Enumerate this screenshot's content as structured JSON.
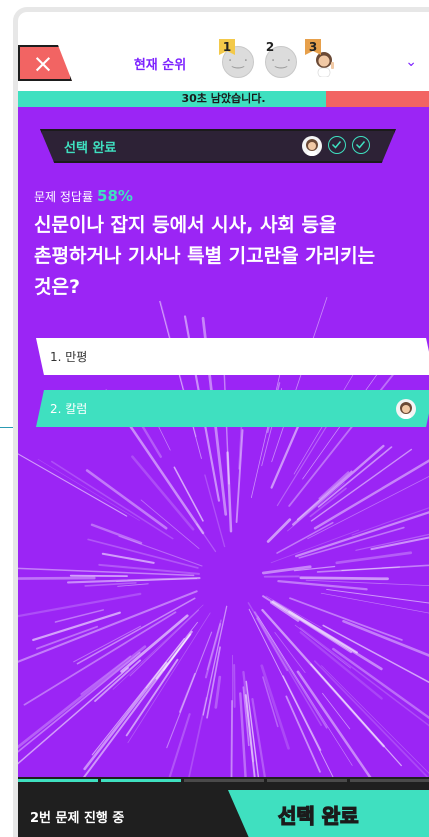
{
  "header": {
    "close_symbol": "×",
    "rank_title": "현재 순위",
    "ranks": [
      {
        "badge": "1",
        "face": "·‿·",
        "icon": "gold-medal-icon"
      },
      {
        "badge": "2",
        "face": "·‿·",
        "icon": "silver-medal-icon"
      },
      {
        "badge": "3",
        "face": "",
        "icon": "bronze-medal-icon"
      }
    ],
    "expand_symbol": "⌄"
  },
  "timer": {
    "text": "30초 남았습니다.",
    "fraction_remaining": 0.75
  },
  "status": {
    "label": "선택 완료",
    "answered_count": 2
  },
  "question": {
    "rate_label": "문제 정답률",
    "rate_value": "58%",
    "text": "신문이나 잡지 등에서 시사, 사회 등을\n촌평하거나 기사나 특별 기고란을 가리키는\n것은?"
  },
  "options": [
    {
      "label": "1. 만평",
      "selected": false
    },
    {
      "label": "2. 칼럼",
      "selected": true
    }
  ],
  "footer": {
    "progress_text": "2번 문제 진행 중",
    "submit_label": "선택 완료",
    "progress_segments": 5,
    "progress_done": 2
  },
  "colors": {
    "accent": "#3fe0c0",
    "background": "#9b25f5",
    "danger": "#f26463",
    "brand_text": "#7d22ff"
  }
}
